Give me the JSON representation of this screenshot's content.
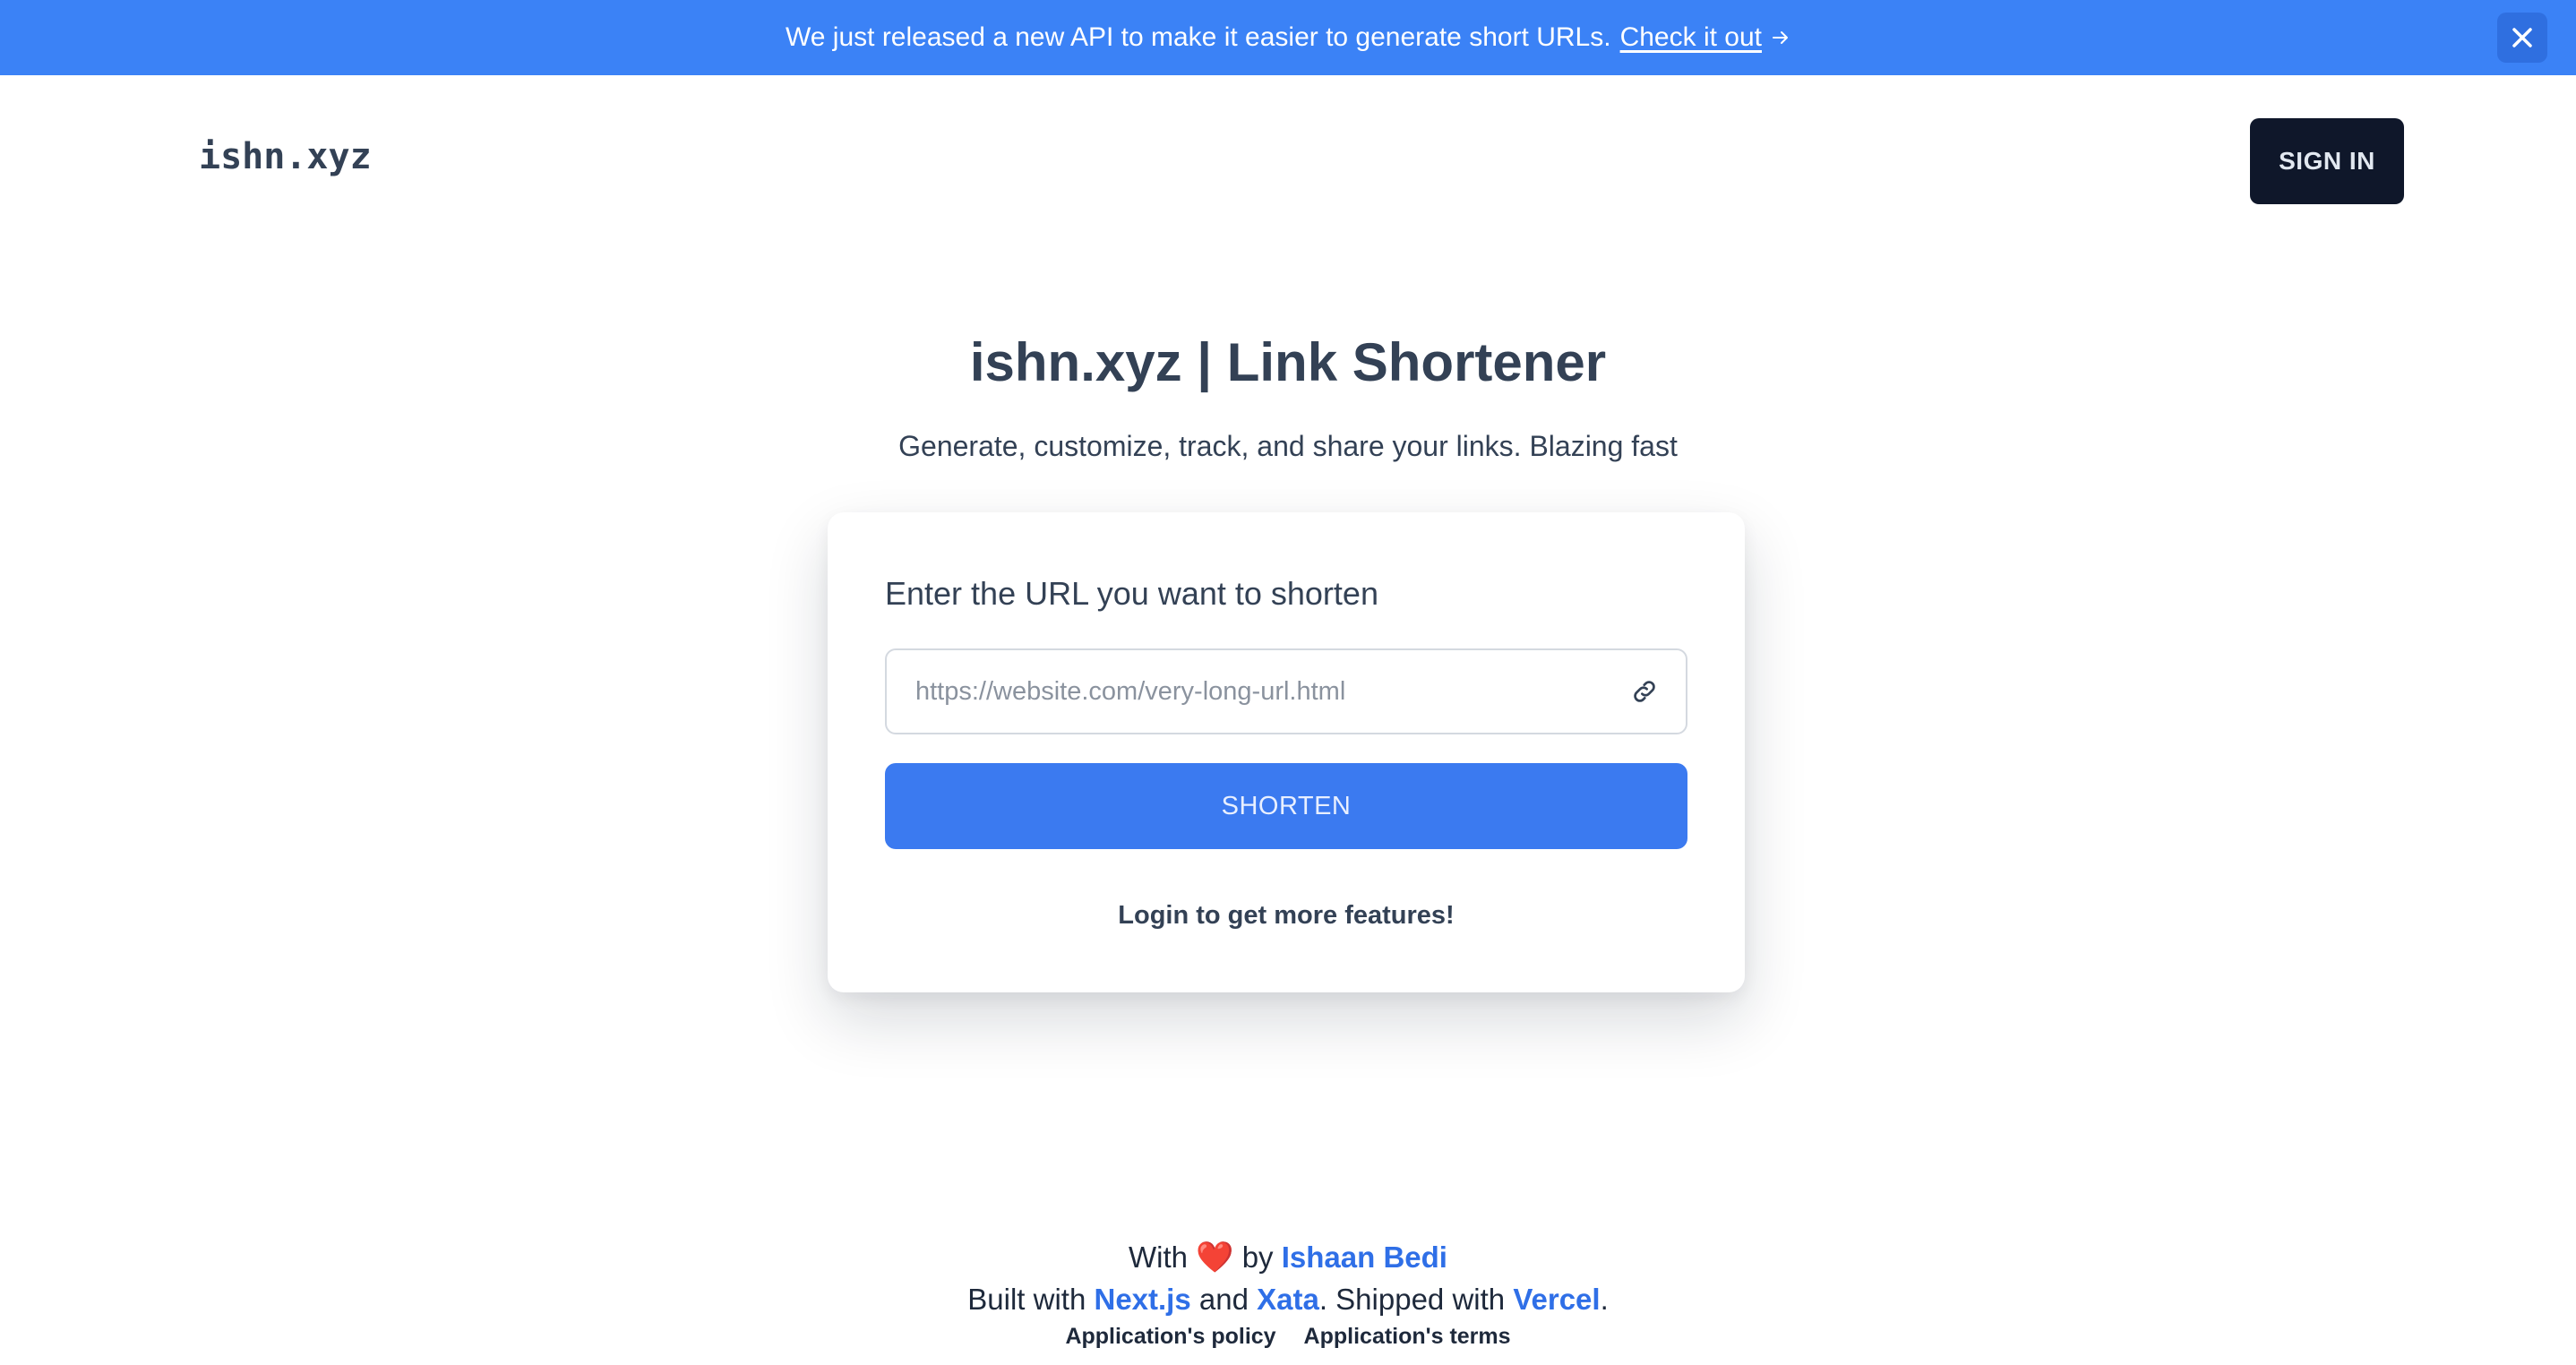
{
  "banner": {
    "text": "We just released a new API to make it easier to generate short URLs.",
    "link_label": "Check it out",
    "arrow_icon": "arrow-right-icon",
    "close_icon": "close-icon",
    "bg_color": "#3b82f6"
  },
  "header": {
    "logo": "ishn.xyz",
    "signin_label": "SIGN IN"
  },
  "hero": {
    "title": "ishn.xyz | Link Shortener",
    "subtitle": "Generate, customize, track, and share your links. Blazing fast"
  },
  "form": {
    "label": "Enter the URL you want to shorten",
    "url_placeholder": "https://website.com/very-long-url.html",
    "url_value": "",
    "link_icon": "link-icon",
    "submit_label": "SHORTEN",
    "login_note": "Login to get more features!",
    "accent_color": "#3b7af0"
  },
  "footer": {
    "with": "With",
    "heart": "❤️",
    "by": "by",
    "author": "Ishaan Bedi",
    "built_with": "Built with",
    "tech1": "Next.js",
    "and": "and",
    "tech2": "Xata",
    "shipped_with": ". Shipped with",
    "host": "Vercel",
    "period": ".",
    "policy_label": "Application's policy",
    "terms_label": "Application's terms",
    "link_color": "#2f6fe7"
  }
}
